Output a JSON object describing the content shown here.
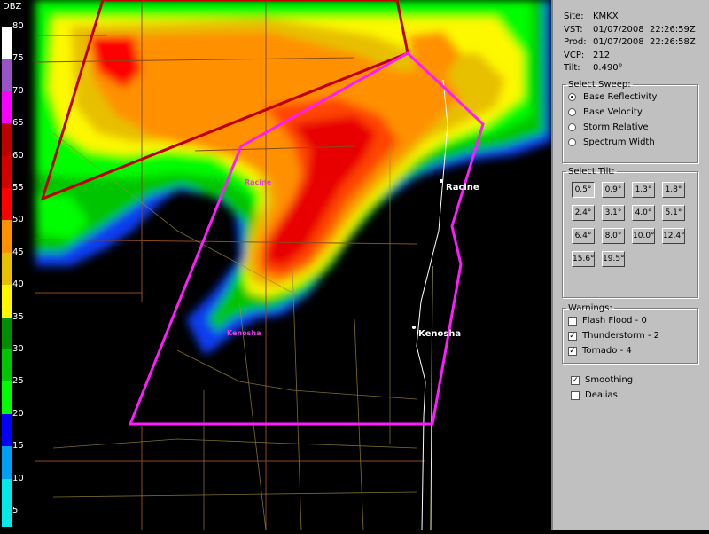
{
  "colorbar": {
    "title": "DBZ",
    "ticks": [
      "80",
      "75",
      "70",
      "65",
      "60",
      "55",
      "50",
      "45",
      "40",
      "35",
      "30",
      "25",
      "20",
      "15",
      "10",
      "5"
    ],
    "colors": [
      "#ffffff",
      "#9854c6",
      "#f800fd",
      "#bc0000",
      "#d40000",
      "#ff0000",
      "#ff9000",
      "#e7c000",
      "#fdf802",
      "#008e00",
      "#01c501",
      "#02fd02",
      "#0300f4",
      "#019ff4",
      "#04e9e7",
      "#04e9e7"
    ]
  },
  "map_labels": {
    "racine_pink": "Racine",
    "kenosha_pink": "Kenosha",
    "racine_white": "Racine",
    "kenosha_white": "Kenosha"
  },
  "info": {
    "site_label": "Site:",
    "site": "KMKX",
    "vst_label": "VST:",
    "vst": "01/07/2008  22:26:59Z",
    "prod_label": "Prod:",
    "prod": "01/07/2008  22:26:58Z",
    "vcp_label": "VCP:",
    "vcp": "212",
    "tilt_label": "Tilt:",
    "tilt": "0.490°"
  },
  "sweep": {
    "legend": "Select Sweep:",
    "options": [
      "Base Reflectivity",
      "Base Velocity",
      "Storm Relative",
      "Spectrum Width"
    ],
    "selected": "Base Reflectivity"
  },
  "tilt": {
    "legend": "Select Tilt:",
    "buttons": [
      "0.5°",
      "0.9°",
      "1.3°",
      "1.8°",
      "2.4°",
      "3.1°",
      "4.0°",
      "5.1°",
      "6.4°",
      "8.0°",
      "10.0°",
      "12.4°",
      "15.6°",
      "19.5°"
    ],
    "active": "0.5°"
  },
  "warnings": {
    "legend": "Warnings:",
    "items": [
      {
        "label": "Flash Flood - 0",
        "checked": false
      },
      {
        "label": "Thunderstorm - 2",
        "checked": true
      },
      {
        "label": "Tornado - 4",
        "checked": true
      }
    ]
  },
  "options": {
    "smoothing": {
      "label": "Smoothing",
      "checked": true
    },
    "dealias": {
      "label": "Dealias",
      "checked": false
    }
  }
}
